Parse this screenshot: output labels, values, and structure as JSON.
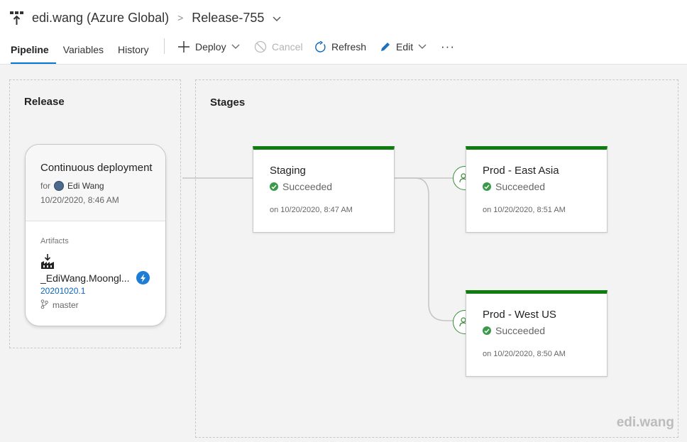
{
  "header": {
    "project": "edi.wang (Azure Global)",
    "release": "Release-755"
  },
  "tabs": [
    {
      "label": "Pipeline",
      "active": true
    },
    {
      "label": "Variables",
      "active": false
    },
    {
      "label": "History",
      "active": false
    }
  ],
  "commands": {
    "deploy": "Deploy",
    "cancel": "Cancel",
    "refresh": "Refresh",
    "edit": "Edit",
    "more": "···"
  },
  "release_panel": {
    "title": "Release",
    "trigger": {
      "title": "Continuous deployment",
      "for_label": "for",
      "user": "Edi Wang",
      "time": "10/20/2020, 8:46 AM"
    },
    "artifacts_label": "Artifacts",
    "artifact": {
      "name": "_EdiWang.Moongl...",
      "version": "20201020.1",
      "branch": "master"
    }
  },
  "stages_panel": {
    "title": "Stages",
    "stages": [
      {
        "name": "Staging",
        "status": "Succeeded",
        "time": "on 10/20/2020, 8:47 AM"
      },
      {
        "name": "Prod - East Asia",
        "status": "Succeeded",
        "time": "on 10/20/2020, 8:51 AM"
      },
      {
        "name": "Prod - West US",
        "status": "Succeeded",
        "time": "on 10/20/2020, 8:50 AM"
      }
    ]
  },
  "colors": {
    "accent": "#0078d4",
    "success": "#107c10",
    "link": "#0a64b8"
  },
  "watermark": "edi.wang"
}
